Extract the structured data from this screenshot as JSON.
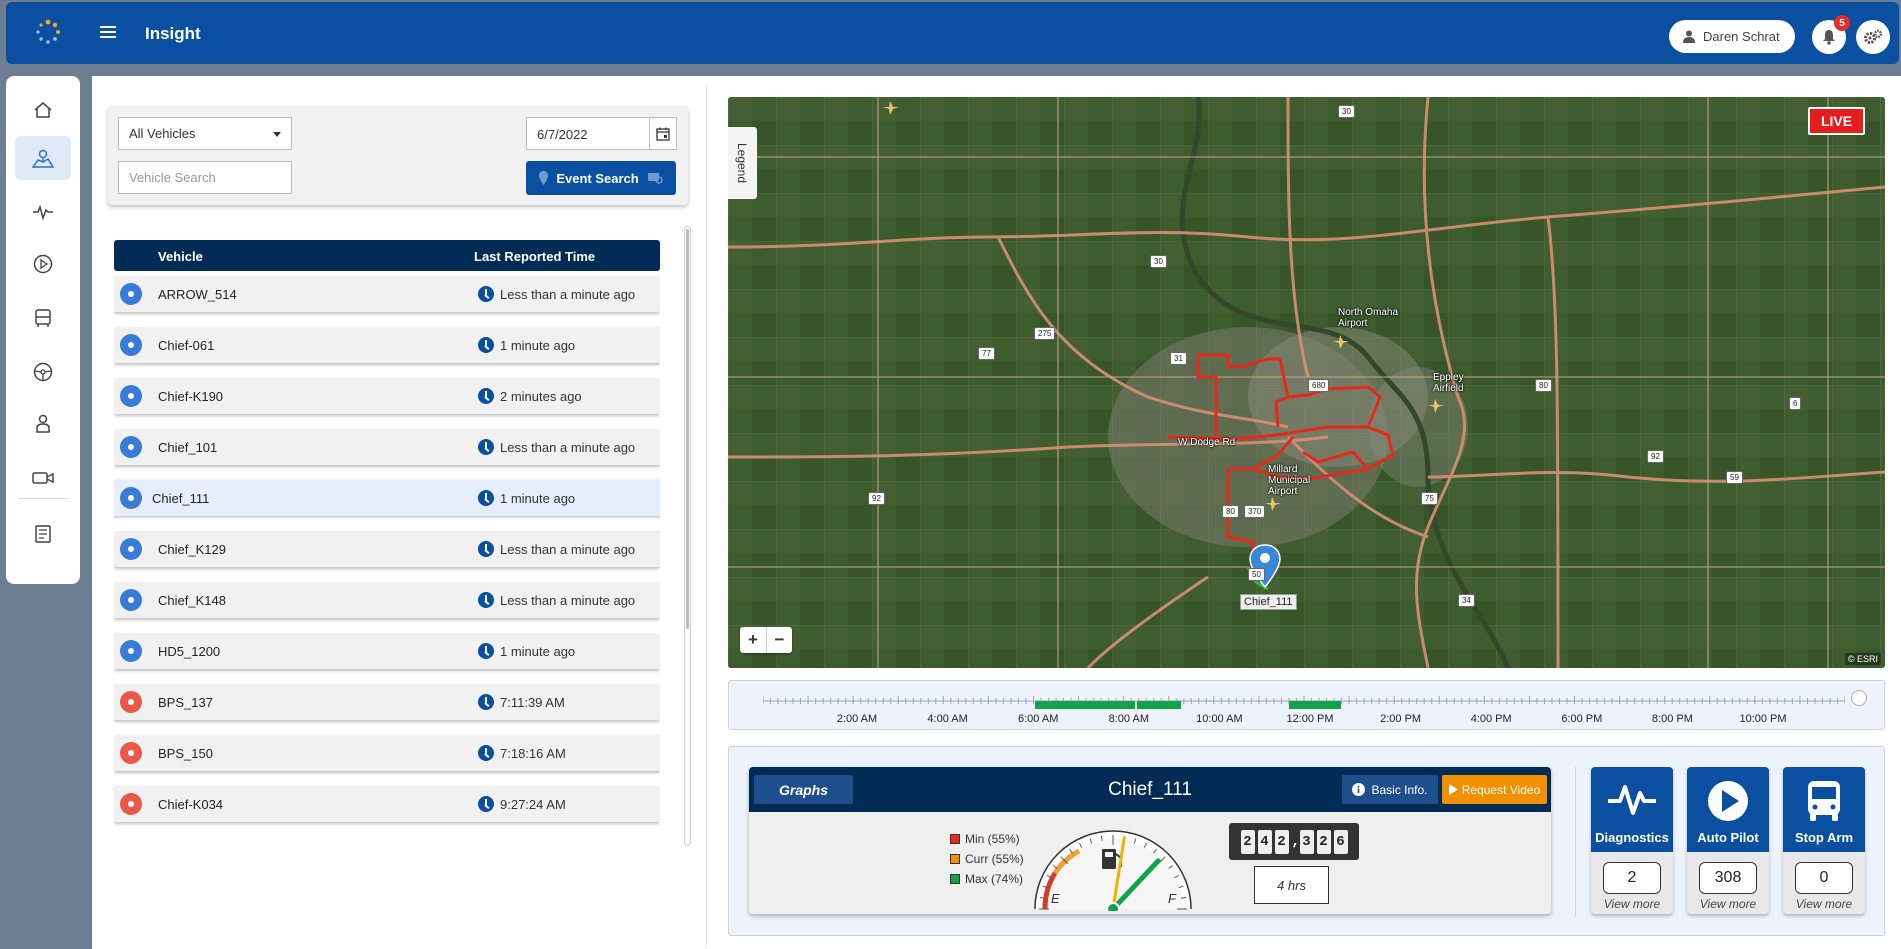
{
  "app": {
    "title": "Insight"
  },
  "header": {
    "user_name": "Daren Schrat",
    "notification_count": "5"
  },
  "filters": {
    "vehicle_select": "All Vehicles",
    "search_placeholder": "Vehicle Search",
    "date": "6/7/2022",
    "event_search_label": "Event Search"
  },
  "vehicle_list": {
    "col_vehicle": "Vehicle",
    "col_time": "Last Reported Time",
    "rows": [
      {
        "name": "ARROW_514",
        "time": "Less than a minute ago",
        "status": "blue"
      },
      {
        "name": "Chief-061",
        "time": "1 minute ago",
        "status": "blue"
      },
      {
        "name": "Chief-K190",
        "time": "2 minutes ago",
        "status": "blue"
      },
      {
        "name": "Chief_101",
        "time": "Less than a minute ago",
        "status": "blue"
      },
      {
        "name": "Chief_111",
        "time": "1 minute ago",
        "status": "blue",
        "selected": true
      },
      {
        "name": "Chief_K129",
        "time": "Less than a minute ago",
        "status": "blue"
      },
      {
        "name": "Chief_K148",
        "time": "Less than a minute ago",
        "status": "blue"
      },
      {
        "name": "HD5_1200",
        "time": "1 minute ago",
        "status": "blue"
      },
      {
        "name": "BPS_137",
        "time": "7:11:39 AM",
        "status": "red"
      },
      {
        "name": "BPS_150",
        "time": "7:18:16 AM",
        "status": "red"
      },
      {
        "name": "Chief-K034",
        "time": "9:27:24 AM",
        "status": "red"
      }
    ]
  },
  "map": {
    "live_label": "LIVE",
    "legend_label": "Legend",
    "attribution": "© ESRI",
    "vehicle_label": "Chief_111",
    "places": {
      "north_omaha": "North Omaha\nAirport",
      "eppley": "Eppley\nAirfield",
      "millard": "Millard\nMunicipal\nAirport",
      "w_dodge": "W Dodge Rd"
    },
    "shields": [
      "30",
      "30",
      "275",
      "77",
      "31",
      "680",
      "80",
      "92",
      "92",
      "59",
      "75",
      "370",
      "80",
      "50",
      "34",
      "6"
    ]
  },
  "timeline": {
    "labels": [
      "2:00 AM",
      "4:00 AM",
      "6:00 AM",
      "8:00 AM",
      "10:00 AM",
      "12:00 PM",
      "2:00 PM",
      "4:00 PM",
      "6:00 PM",
      "8:00 PM",
      "10:00 PM"
    ]
  },
  "dashboard": {
    "graphs_label": "Graphs",
    "vehicle_title": "Chief_111",
    "basic_info_label": "Basic Info.",
    "request_video_label": "Request Video",
    "fuel": {
      "min_label": "Min (55%)",
      "curr_label": "Curr (55%)",
      "max_label": "Max (74%)",
      "min": 55,
      "curr": 55,
      "max": 74,
      "empty_label": "E",
      "full_label": "F"
    },
    "odometer_digits": [
      "2",
      "4",
      "2",
      ",",
      "3",
      "2",
      "6"
    ],
    "hours": "4 hrs",
    "stats": [
      {
        "label": "Diagnostics",
        "value": "2",
        "more": "View more"
      },
      {
        "label": "Auto Pilot",
        "value": "308",
        "more": "View more"
      },
      {
        "label": "Stop Arm",
        "value": "0",
        "more": "View more"
      }
    ]
  },
  "colors": {
    "brand": "#0a4fa0",
    "header_dark": "#022b55",
    "status_blue": "#3a7bd5",
    "status_red": "#e8594a",
    "route_red": "#e8281b",
    "request_orange": "#f29000",
    "timeline_green": "#12a34a"
  }
}
